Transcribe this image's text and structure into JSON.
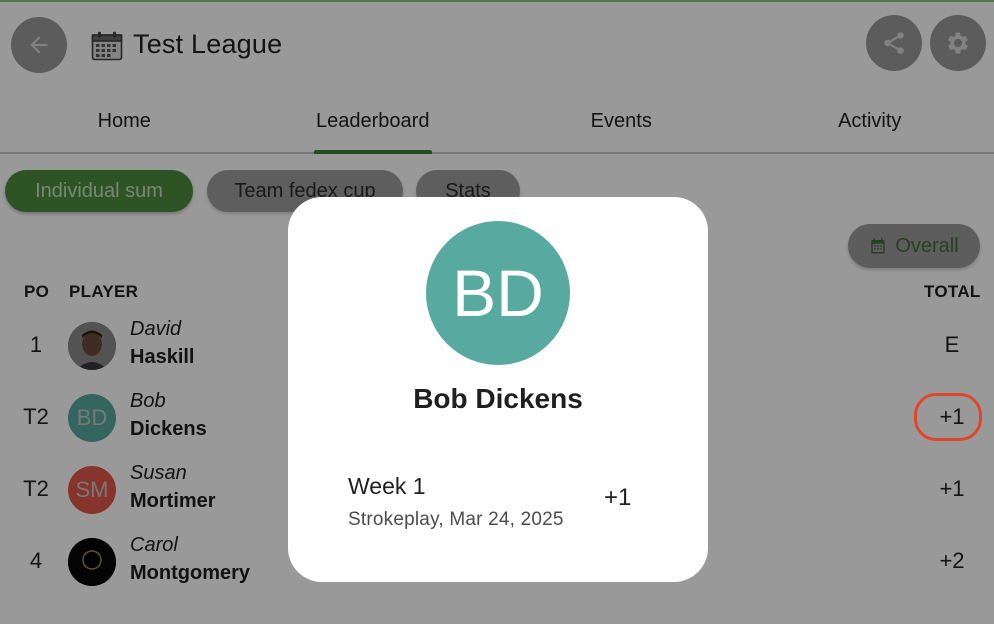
{
  "header": {
    "title": "Test League",
    "back_icon": "arrow-left-icon",
    "calendar_icon": "calendar-icon",
    "share_icon": "share-icon",
    "settings_icon": "gear-icon"
  },
  "tabs": [
    {
      "label": "Home",
      "active": false
    },
    {
      "label": "Leaderboard",
      "active": true
    },
    {
      "label": "Events",
      "active": false
    },
    {
      "label": "Activity",
      "active": false
    }
  ],
  "chips": [
    {
      "label": "Individual sum",
      "selected": true
    },
    {
      "label": "Team fedex cup",
      "selected": false
    },
    {
      "label": "Stats",
      "selected": false
    }
  ],
  "filter": {
    "label": "Overall",
    "icon": "calendar-icon"
  },
  "table": {
    "columns": {
      "pos": "PO",
      "player": "PLAYER",
      "total": "TOTAL"
    },
    "rows": [
      {
        "pos": "1",
        "first": "David",
        "last": "Haskill",
        "avatar_initials": "",
        "avatar_type": "photo",
        "total": "E"
      },
      {
        "pos": "T2",
        "first": "Bob",
        "last": "Dickens",
        "avatar_initials": "BD",
        "avatar_color": "#58aaa0",
        "total": "+1"
      },
      {
        "pos": "T2",
        "first": "Susan",
        "last": "Mortimer",
        "avatar_initials": "SM",
        "avatar_color": "#e0574a",
        "total": "+1"
      },
      {
        "pos": "4",
        "first": "Carol",
        "last": "Montgomery",
        "avatar_initials": "",
        "avatar_type": "photo-eclipse",
        "total": "+2"
      }
    ]
  },
  "dialog": {
    "avatar_initials": "BD",
    "avatar_color": "#58aaa0",
    "name": "Bob Dickens",
    "event": {
      "title": "Week 1",
      "subtitle": "Strokeplay, Mar 24, 2025",
      "score": "+1"
    }
  },
  "colors": {
    "accent_green": "#3f7d33",
    "highlight_red": "#e0462a"
  }
}
